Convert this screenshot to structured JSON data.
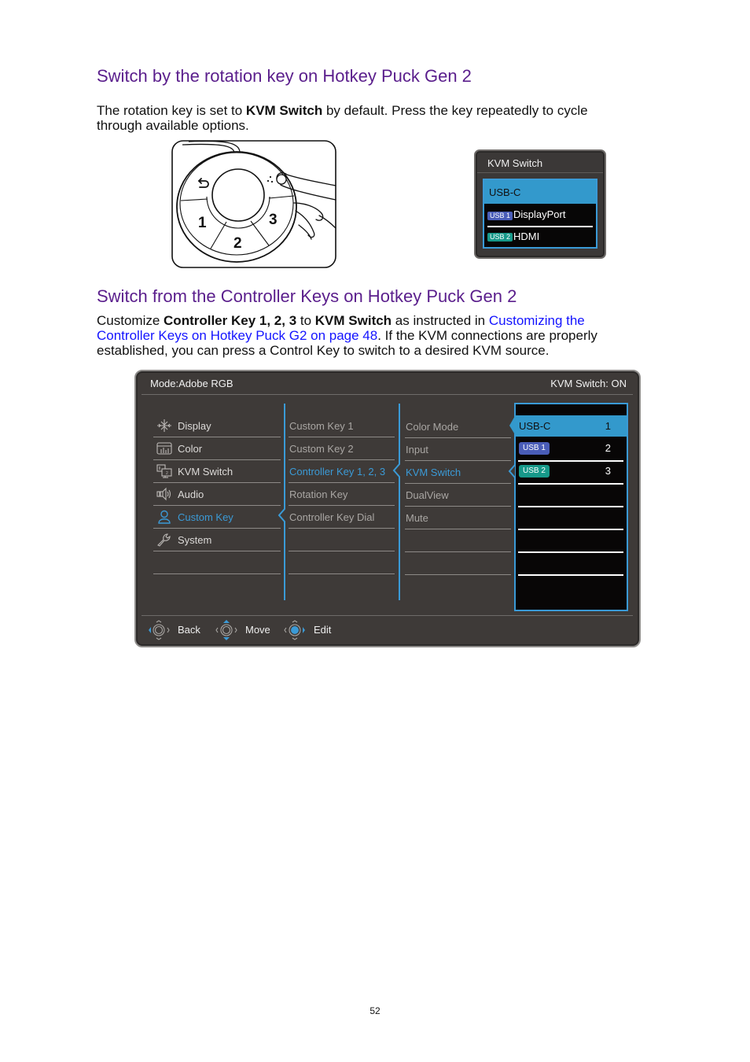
{
  "section1": {
    "heading": "Switch by the rotation key on Hotkey Puck Gen 2",
    "para": {
      "t1": "The rotation key is set to ",
      "b1": "KVM Switch",
      "t2": " by default. Press the key repeatedly to cycle",
      "t3": "through available options."
    }
  },
  "puck_illustration": {
    "key_labels": [
      "1",
      "2",
      "3"
    ],
    "icons": [
      "back-arrow-icon",
      "rotation-key-icon",
      "finger-icon"
    ]
  },
  "kvm_popup": {
    "title": "KVM Switch",
    "items": [
      {
        "label": "USB-C",
        "selected": true
      },
      {
        "label": "DisplayPort",
        "badge": "USB 1"
      },
      {
        "label": "HDMI",
        "badge": "USB 2"
      }
    ]
  },
  "section2": {
    "heading": "Switch from the Controller Keys on Hotkey Puck Gen 2",
    "para": {
      "t1": "Customize ",
      "b1": "Controller Key 1, 2, 3",
      "t2": " to ",
      "b2": "KVM Switch",
      "t3": " as instructed in ",
      "link_line1": "Customizing the",
      "link_line2": "Controller Keys on Hotkey Puck G2 on page 48",
      "t4": ". If the KVM connections are properly",
      "t5": "established, you can press a Control Key to switch to a desired KVM source."
    }
  },
  "osd": {
    "mode": "Mode:Adobe RGB",
    "kvm_status": "KVM Switch: ON",
    "main_menu": [
      {
        "label": "Display",
        "icon": "display-icon"
      },
      {
        "label": "Color",
        "icon": "color-icon"
      },
      {
        "label": "KVM Switch",
        "icon": "kvm-switch-icon"
      },
      {
        "label": "Audio",
        "icon": "audio-icon"
      },
      {
        "label": "Custom Key",
        "icon": "custom-key-icon",
        "active": true
      },
      {
        "label": "System",
        "icon": "system-icon"
      }
    ],
    "submenu": [
      {
        "label": "Custom Key 1"
      },
      {
        "label": "Custom Key 2"
      },
      {
        "label": "Controller Key 1, 2, 3",
        "active": true
      },
      {
        "label": "Rotation Key"
      },
      {
        "label": "Controller Key Dial"
      }
    ],
    "function_menu": [
      {
        "label": "Color Mode"
      },
      {
        "label": "Input"
      },
      {
        "label": "KVM Switch",
        "active": true
      },
      {
        "label": "DualView"
      },
      {
        "label": "Mute"
      }
    ],
    "options": [
      {
        "label": "USB-C",
        "key": "1",
        "selected": true
      },
      {
        "badge": "USB 1",
        "key": "2"
      },
      {
        "badge": "USB 2",
        "key": "3"
      }
    ],
    "footer": [
      {
        "label": "Back",
        "icon": "joystick-left-icon"
      },
      {
        "label": "Move",
        "icon": "joystick-up-down-icon"
      },
      {
        "label": "Edit",
        "icon": "joystick-press-icon"
      }
    ]
  },
  "page_number": "52",
  "colors": {
    "heading": "#5a1e8c",
    "link": "#1414ff",
    "osd_background": "#3e3a38",
    "osd_accent": "#3b9ad6",
    "osd_highlight": "#3399cc",
    "badge_usb1": "#4a5db8",
    "badge_usb2": "#17998a"
  }
}
